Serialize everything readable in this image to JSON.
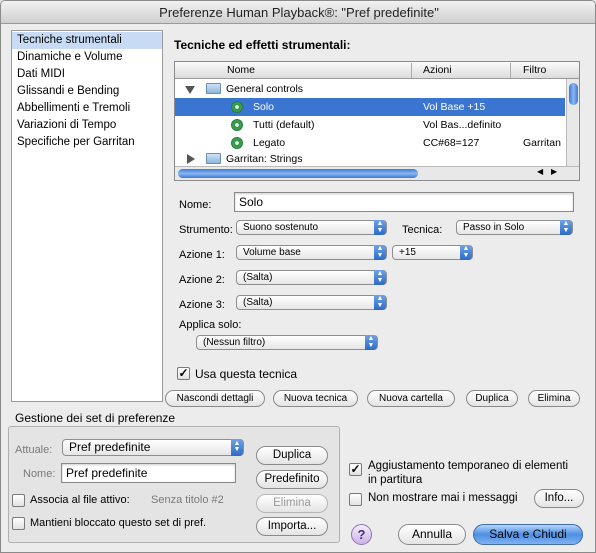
{
  "window": {
    "title": "Preferenze Human Playback®: \"Pref predefinite\""
  },
  "sidebar": {
    "items": [
      {
        "label": "Tecniche strumentali",
        "selected": true
      },
      {
        "label": "Dinamiche e Volume"
      },
      {
        "label": "Dati MIDI"
      },
      {
        "label": "Glissandi e Bending"
      },
      {
        "label": "Abbellimenti e Tremoli"
      },
      {
        "label": "Variazioni di Tempo"
      },
      {
        "label": "Specifiche per Garritan"
      }
    ]
  },
  "main": {
    "heading": "Tecniche ed effetti strumentali:",
    "table": {
      "columns": [
        "Nome",
        "Azioni",
        "Filtro"
      ],
      "rows": [
        {
          "name": "General controls",
          "actions": "",
          "filter": "",
          "kind": "folder",
          "expanded": true
        },
        {
          "name": "Solo",
          "actions": "Vol Base +15",
          "filter": "",
          "kind": "item",
          "selected": true
        },
        {
          "name": "Tutti (default)",
          "actions": "Vol Bas...definito",
          "filter": "",
          "kind": "item"
        },
        {
          "name": "Legato",
          "actions": "CC#68=127",
          "filter": "Garritan",
          "kind": "item"
        },
        {
          "name": "Garritan: Strings",
          "actions": "",
          "filter": "",
          "kind": "folder",
          "expanded": false
        }
      ]
    },
    "nome_label": "Nome:",
    "nome_value": "Solo",
    "strumento_label": "Strumento:",
    "strumento_value": "Suono sostenuto",
    "tecnica_label": "Tecnica:",
    "tecnica_value": "Passo in Solo",
    "azione1_label": "Azione 1:",
    "azione1_value": "Volume base",
    "azione1_amount": "+15",
    "azione2_label": "Azione 2:",
    "azione2_value": "(Salta)",
    "azione3_label": "Azione 3:",
    "azione3_value": "(Salta)",
    "applica_label": "Applica solo:",
    "applica_value": "(Nessun filtro)",
    "usa_label": "Usa questa tecnica",
    "usa_checked": true,
    "buttons": {
      "nascondi": "Nascondi dettagli",
      "nuova_tecnica": "Nuova tecnica",
      "nuova_cartella": "Nuova cartella",
      "duplica": "Duplica",
      "elimina": "Elimina"
    }
  },
  "gestione": {
    "title": "Gestione dei set di preferenze",
    "attuale_label": "Attuale:",
    "attuale_value": "Pref predefinite",
    "nome_label": "Nome:",
    "nome_value": "Pref predefinite",
    "associa_label": "Associa al file attivo:",
    "associa_file": "Senza titolo #2",
    "mantieni_label": "Mantieni bloccato questo set di pref.",
    "duplica": "Duplica",
    "predefinito": "Predefinito",
    "elimina": "Elimina",
    "importa": "Importa..."
  },
  "options": {
    "aggiustamento_line1": "Aggiustamento temporaneo di elementi",
    "aggiustamento_line2": "in partitura",
    "aggiustamento_checked": true,
    "non_mostrare": "Non mostrare mai i messaggi",
    "non_mostrare_checked": false,
    "info": "Info..."
  },
  "footer": {
    "help": "?",
    "annulla": "Annulla",
    "salva": "Salva e Chiudi"
  }
}
